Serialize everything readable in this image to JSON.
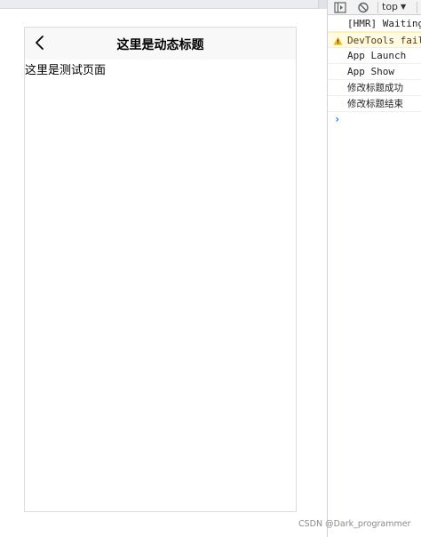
{
  "phone": {
    "nav_title": "这里是动态标题",
    "content_text": "这里是测试页面"
  },
  "devtools": {
    "context_selector": "top",
    "console_messages": [
      {
        "level": "log",
        "text": "[HMR] Waiting"
      },
      {
        "level": "warning",
        "text": "DevTools fail"
      },
      {
        "level": "log",
        "text": "App Launch"
      },
      {
        "level": "log",
        "text": "App Show"
      },
      {
        "level": "log",
        "text": "修改标题成功"
      },
      {
        "level": "log",
        "text": "修改标题结束"
      }
    ],
    "prompt_symbol": "›"
  },
  "watermark": "CSDN @Dark_programmer",
  "icons": {
    "back": "chevron-left-icon",
    "sidebar_toggle": "sidebar-toggle-icon",
    "clear": "clear-console-icon",
    "warning": "warning-icon"
  },
  "colors": {
    "warning_bg": "#fffbe5",
    "warning_icon": "#f4b400",
    "prompt": "#1a73e8",
    "navbar_bg": "#f8f8f8"
  }
}
